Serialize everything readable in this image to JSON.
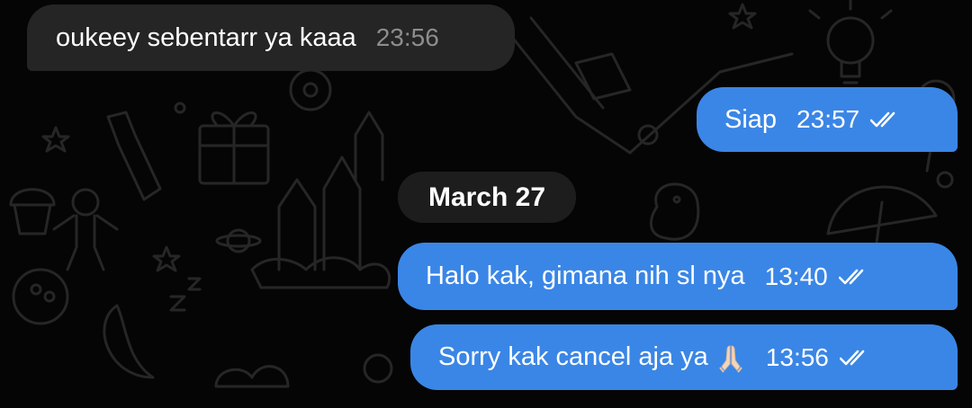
{
  "date_separator": "March 27",
  "colors": {
    "background": "#050505",
    "incoming_bubble": "#252525",
    "outgoing_bubble": "#3a86e6",
    "incoming_time": "#8d8d8d",
    "date_pill": "#1d1d1d"
  },
  "messages": [
    {
      "direction": "incoming",
      "text": "oukeey sebentarr ya kaaa",
      "time": "23:56"
    },
    {
      "direction": "outgoing",
      "text": "Siap",
      "time": "23:57",
      "status_icon": "double-check-icon"
    },
    {
      "direction": "outgoing",
      "text": "Halo kak, gimana nih sl nya",
      "time": "13:40",
      "status_icon": "double-check-icon"
    },
    {
      "direction": "outgoing",
      "text": "Sorry kak cancel aja ya",
      "emoji": "folded-hands-emoji",
      "time": "13:56",
      "status_icon": "double-check-icon"
    }
  ]
}
